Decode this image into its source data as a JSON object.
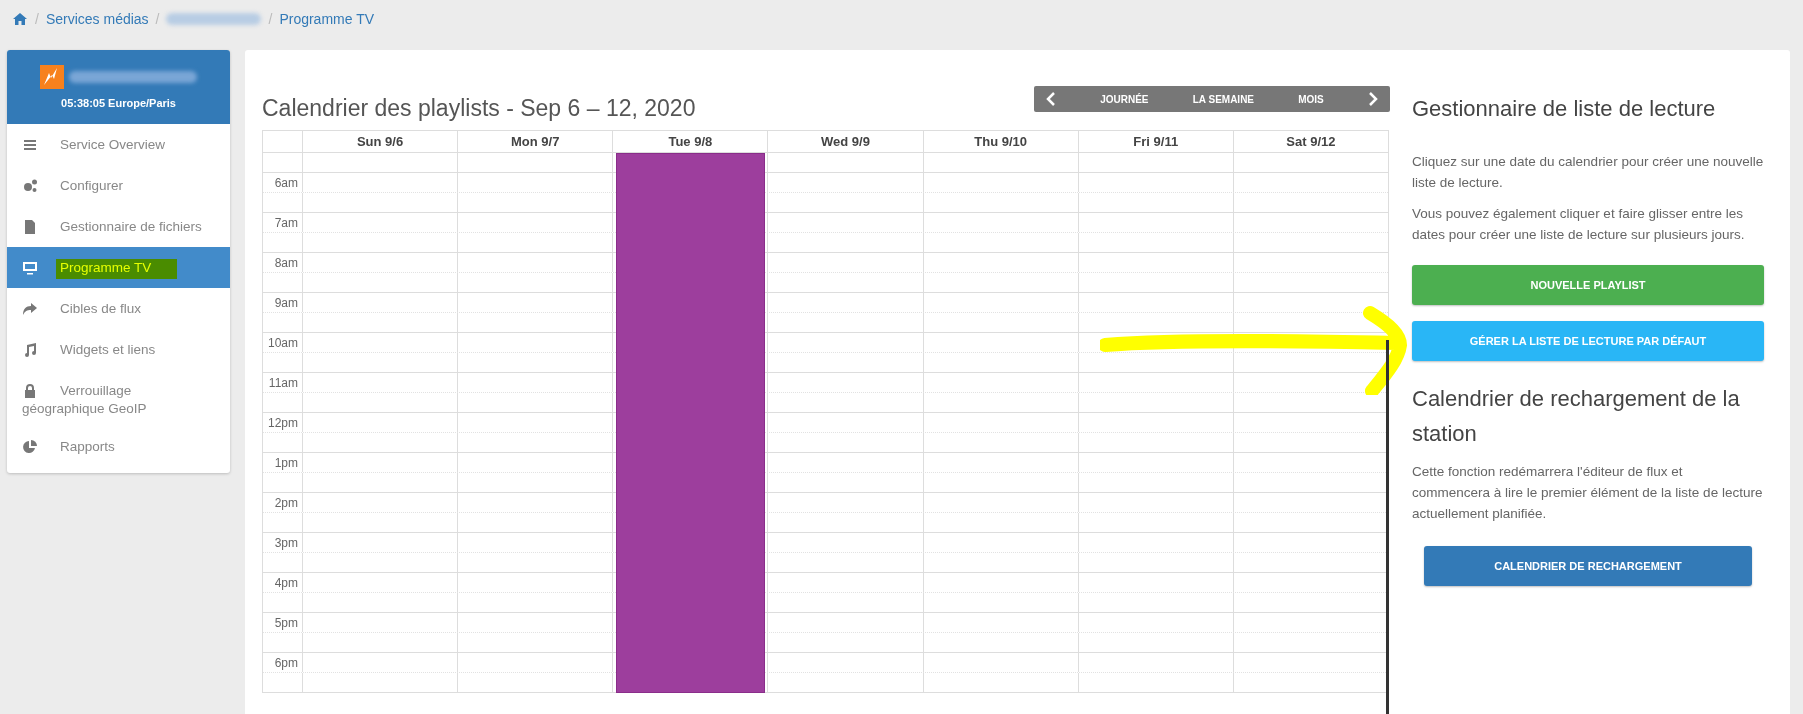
{
  "breadcrumb": {
    "separator": "/",
    "items": [
      "Services médias",
      "Programme TV"
    ]
  },
  "sidebar": {
    "time": "05:38:05 Europe/Paris",
    "items": [
      {
        "label": "Service Overview",
        "selected": false
      },
      {
        "label": "Configurer",
        "selected": false
      },
      {
        "label": "Gestionnaire de fichiers",
        "selected": false
      },
      {
        "label": "Programme TV",
        "selected": true
      },
      {
        "label": "Cibles de flux",
        "selected": false
      },
      {
        "label": "Widgets et liens",
        "selected": false
      },
      {
        "label": "Verrouillage géographique GeoIP",
        "selected": false
      },
      {
        "label": "Rapports",
        "selected": false
      }
    ]
  },
  "calendar": {
    "title": "Calendrier des playlists - Sep 6 – 12, 2020",
    "views": [
      "JOURNÉE",
      "LA SEMAINE",
      "MOIS"
    ],
    "days": [
      {
        "label": "Sun 9/6",
        "event": false
      },
      {
        "label": "Mon 9/7",
        "event": false
      },
      {
        "label": "Tue 9/8",
        "event": true
      },
      {
        "label": "Wed 9/9",
        "event": false
      },
      {
        "label": "Thu 9/10",
        "event": false
      },
      {
        "label": "Fri 9/11",
        "event": false
      },
      {
        "label": "Sat 9/12",
        "event": false
      }
    ],
    "hours": [
      "6am",
      "7am",
      "8am",
      "9am",
      "10am",
      "11am",
      "12pm",
      "1pm",
      "2pm",
      "3pm",
      "4pm",
      "5pm",
      "6pm"
    ]
  },
  "manager": {
    "title": "Gestionnaire de liste de lecture",
    "paragraphs": [
      "Cliquez sur une date du calendrier pour créer une nouvelle liste de lecture.",
      "Vous pouvez également cliquer et faire glisser entre les dates pour créer une liste de lecture sur plusieurs jours."
    ],
    "buttons": [
      "NOUVELLE PLAYLIST",
      "GÉRER LA LISTE DE LECTURE PAR DÉFAUT"
    ]
  },
  "reload": {
    "title": "Calendrier de rechargement de la station",
    "text": "Cette fonction redémarrera l'éditeur de flux et commencera à lire le premier élément de la liste de lecture actuellement planifiée.",
    "button": "CALENDRIER DE RECHARGEMENT"
  }
}
